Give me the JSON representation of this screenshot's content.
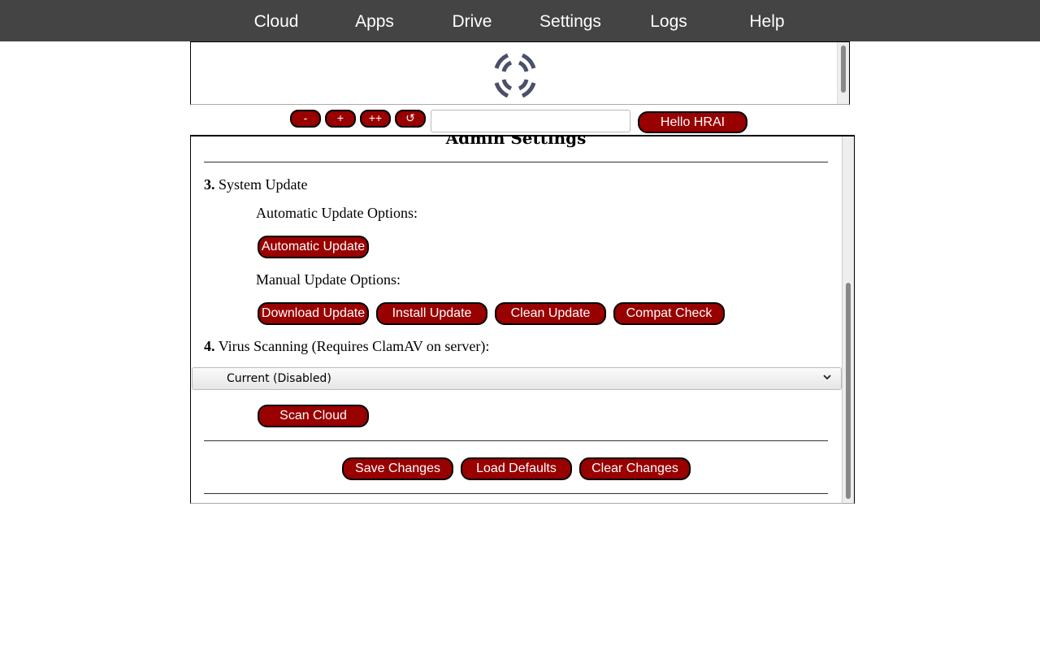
{
  "nav": {
    "items": [
      {
        "label": "Cloud"
      },
      {
        "label": "Apps"
      },
      {
        "label": "Drive"
      },
      {
        "label": "Settings"
      },
      {
        "label": "Logs"
      },
      {
        "label": "Help"
      }
    ]
  },
  "toolbar": {
    "zoom_out_label": "-",
    "zoom_in_label": "+",
    "zoom_max_label": "++",
    "reset_label": "↺",
    "search_value": "",
    "user_button_label": "Hello HRAI"
  },
  "panel": {
    "title": "Admin Settings",
    "section3": {
      "number": "3.",
      "title": "System Update",
      "auto_label": "Automatic Update Options:",
      "auto_button": "Automatic Update",
      "manual_label": "Manual Update Options:",
      "manual_buttons": [
        "Download Update",
        "Install Update",
        "Clean Update",
        "Compat Check"
      ]
    },
    "section4": {
      "number": "4.",
      "title": "Virus Scanning (Requires ClamAV on server):",
      "select_value": "Current (Disabled)",
      "scan_button": "Scan Cloud"
    },
    "actions": {
      "save": "Save Changes",
      "load_defaults": "Load Defaults",
      "clear": "Clear Changes"
    }
  },
  "colors": {
    "nav_bg": "#444444",
    "button_bg": "#990000",
    "button_text": "#ffffff",
    "logo": "#4a4f6a"
  }
}
